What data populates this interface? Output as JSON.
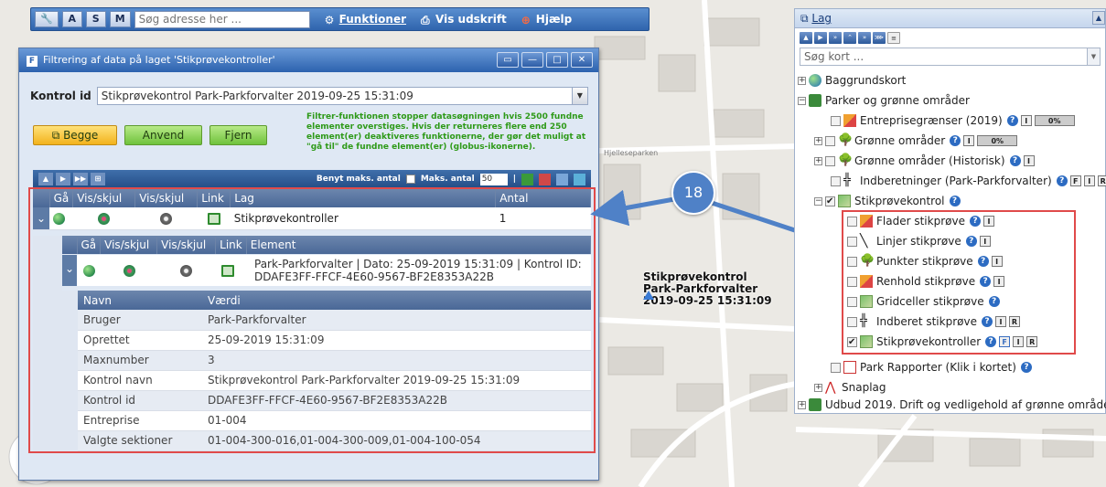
{
  "toolbar": {
    "mode_buttons": [
      "A",
      "S",
      "M"
    ],
    "search_placeholder": "Søg adresse her ...",
    "funktioner": "Funktioner",
    "vis_udskrift": "Vis udskrift",
    "hjaelp": "Hjælp"
  },
  "map": {
    "marker_label": [
      "Stikprøvekontrol",
      "Park-Parkforvalter",
      "2019-09-25 15:31:09"
    ],
    "street_label": "Hjelleseparken"
  },
  "dialog": {
    "title": "Filtrering af data på laget 'Stikprøvekontroller'",
    "kontrol_id_label": "Kontrol id",
    "kontrol_id_value": "Stikprøvekontrol Park-Parkforvalter 2019-09-25 15:31:09",
    "buttons": {
      "begge": "Begge",
      "anvend": "Anvend",
      "fjern": "Fjern"
    },
    "warning": "Filtrer-funktionen stopper datasøgningen hvis 2500 fundne elementer overstiges. Hvis der returneres flere end 250 element(er) deaktiveres funktionerne, der gør det muligt at \"gå til\" de fundne element(er) (globus-ikonerne).",
    "grid_bar": {
      "benyt": "Benyt maks. antal",
      "maks": "Maks. antal",
      "maks_value": "50"
    },
    "layer_grid": {
      "headers": [
        "Gå",
        "Vis/skjul",
        "Vis/skjul",
        "Link",
        "Lag",
        "Antal"
      ],
      "row": {
        "lag": "Stikprøvekontroller",
        "antal": "1"
      }
    },
    "element_grid": {
      "headers": [
        "Gå",
        "Vis/skjul",
        "Vis/skjul",
        "Link",
        "Element"
      ],
      "element_line1": "Park-Parkforvalter | Dato: 25-09-2019 15:31:09 | Kontrol ID:",
      "element_line2": "DDAFE3FF-FFCF-4E60-9567-BF2E8353A22B"
    },
    "properties": {
      "headers": [
        "Navn",
        "Værdi"
      ],
      "rows": [
        {
          "navn": "Bruger",
          "vaerdi": "Park-Parkforvalter"
        },
        {
          "navn": "Oprettet",
          "vaerdi": "25-09-2019 15:31:09"
        },
        {
          "navn": "Maxnumber",
          "vaerdi": "3"
        },
        {
          "navn": "Kontrol navn",
          "vaerdi": "Stikprøvekontrol Park-Parkforvalter 2019-09-25 15:31:09"
        },
        {
          "navn": "Kontrol id",
          "vaerdi": "DDAFE3FF-FFCF-4E60-9567-BF2E8353A22B"
        },
        {
          "navn": "Entreprise",
          "vaerdi": "01-004"
        },
        {
          "navn": "Valgte sektioner",
          "vaerdi": "01-004-300-016,01-004-300-009,01-004-100-054"
        }
      ]
    }
  },
  "callout": "18",
  "layer_panel": {
    "title": "Lag",
    "search_placeholder": "Søg kort ...",
    "items": [
      {
        "label": "Baggrundskort"
      },
      {
        "label": "Parker og grønne områder"
      },
      {
        "label": "Entreprisegrænser (2019)",
        "pct": "0%"
      },
      {
        "label": "Grønne områder",
        "pct": "0%"
      },
      {
        "label": "Grønne områder (Historisk)"
      },
      {
        "label": "Indberetninger (Park-Parkforvalter)"
      },
      {
        "label": "Stikprøvekontrol"
      },
      {
        "label": "Flader stikprøve"
      },
      {
        "label": "Linjer stikprøve"
      },
      {
        "label": "Punkter stikprøve"
      },
      {
        "label": "Renhold stikprøve"
      },
      {
        "label": "Gridceller stikprøve"
      },
      {
        "label": "Indberet stikprøve"
      },
      {
        "label": "Stikprøvekontroller"
      },
      {
        "label": "Park Rapporter (Klik i kortet)"
      },
      {
        "label": "Snaplag"
      },
      {
        "label": "Udbud 2019. Drift og vedligehold af grønne områder"
      }
    ],
    "badges": {
      "f": "F",
      "i": "I",
      "r": "R",
      "q": "?"
    }
  },
  "colors": {
    "accent_blue": "#2c62ae",
    "highlight_red": "#e04a4a",
    "button_green": "#6fc23c",
    "button_yellow": "#f2b21c",
    "warning_green": "#2e9a18"
  }
}
